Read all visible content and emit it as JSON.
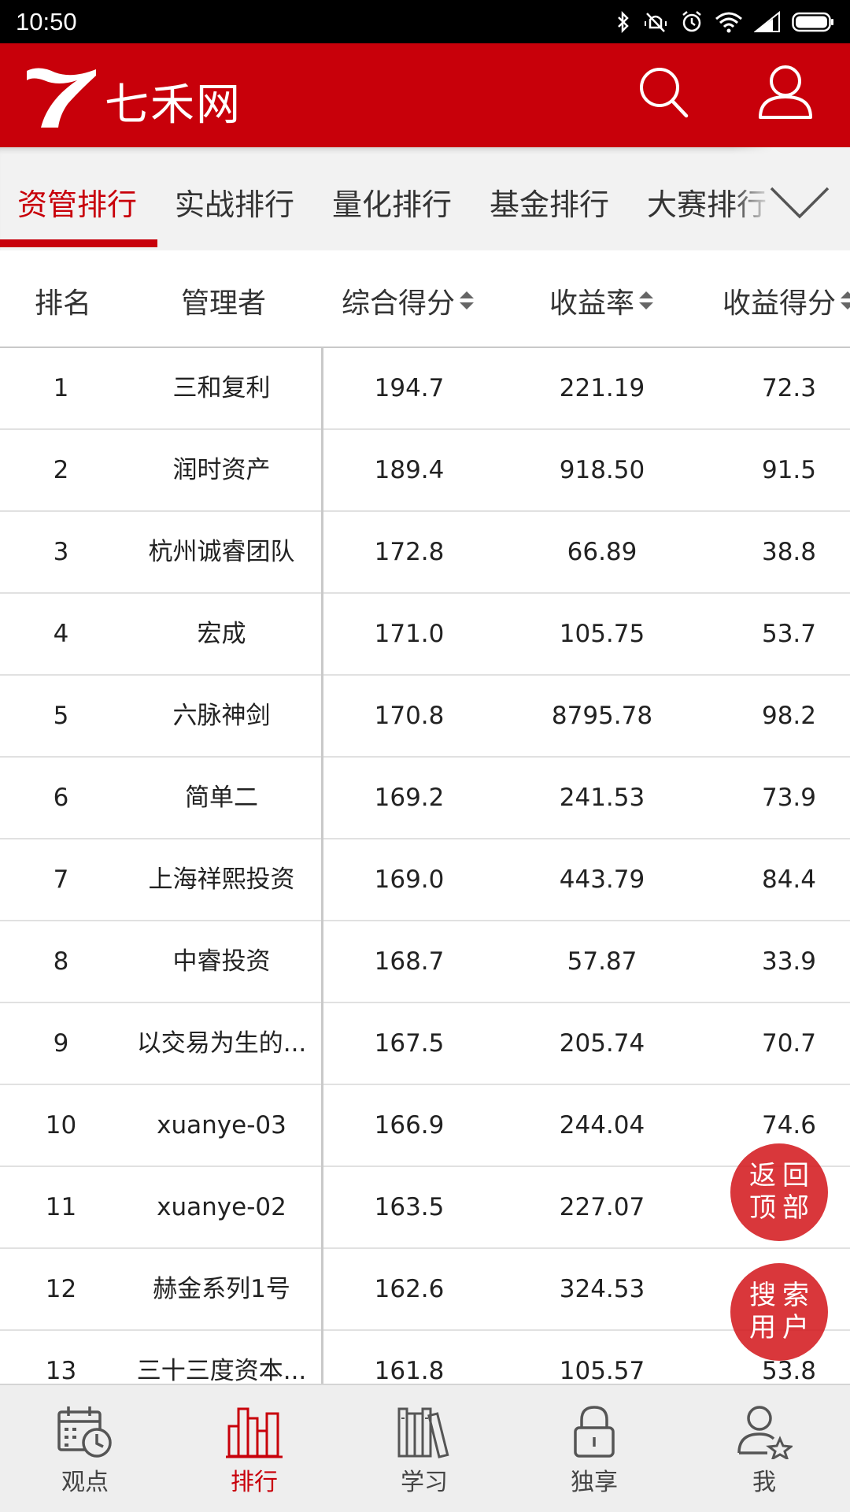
{
  "status_bar": {
    "time": "10:50"
  },
  "header": {
    "app_title": "七禾网"
  },
  "tabs": [
    {
      "label": "资管排行",
      "active": true
    },
    {
      "label": "实战排行",
      "active": false
    },
    {
      "label": "量化排行",
      "active": false
    },
    {
      "label": "基金排行",
      "active": false
    },
    {
      "label": "大赛排行",
      "active": false
    }
  ],
  "table": {
    "headers": {
      "rank": "排名",
      "manager": "管理者",
      "composite_score": "综合得分",
      "return_rate": "收益率",
      "return_score": "收益得分"
    },
    "rows": [
      {
        "rank": "1",
        "manager": "三和复利",
        "score": "194.7",
        "return": "221.19",
        "rscore": "72.3"
      },
      {
        "rank": "2",
        "manager": "润时资产",
        "score": "189.4",
        "return": "918.50",
        "rscore": "91.5"
      },
      {
        "rank": "3",
        "manager": "杭州诚睿团队",
        "score": "172.8",
        "return": "66.89",
        "rscore": "38.8"
      },
      {
        "rank": "4",
        "manager": "宏成",
        "score": "171.0",
        "return": "105.75",
        "rscore": "53.7"
      },
      {
        "rank": "5",
        "manager": "六脉神剑",
        "score": "170.8",
        "return": "8795.78",
        "rscore": "98.2"
      },
      {
        "rank": "6",
        "manager": "简单二",
        "score": "169.2",
        "return": "241.53",
        "rscore": "73.9"
      },
      {
        "rank": "7",
        "manager": "上海祥熙投资",
        "score": "169.0",
        "return": "443.79",
        "rscore": "84.4"
      },
      {
        "rank": "8",
        "manager": "中睿投资",
        "score": "168.7",
        "return": "57.87",
        "rscore": "33.9"
      },
      {
        "rank": "9",
        "manager": "以交易为生的...",
        "score": "167.5",
        "return": "205.74",
        "rscore": "70.7"
      },
      {
        "rank": "10",
        "manager": "xuanye-03",
        "score": "166.9",
        "return": "244.04",
        "rscore": "74.6"
      },
      {
        "rank": "11",
        "manager": "xuanye-02",
        "score": "163.5",
        "return": "227.07",
        "rscore": ""
      },
      {
        "rank": "12",
        "manager": "赫金系列1号",
        "score": "162.6",
        "return": "324.53",
        "rscore": ""
      },
      {
        "rank": "13",
        "manager": "三十三度资本...",
        "score": "161.8",
        "return": "105.57",
        "rscore": "53.8"
      }
    ]
  },
  "floating": {
    "back_to_top_line1": "返回",
    "back_to_top_line2": "顶部",
    "search_user_line1": "搜索",
    "search_user_line2": "用户"
  },
  "bottom_nav": [
    {
      "label": "观点",
      "icon": "calendar-clock-icon",
      "active": false
    },
    {
      "label": "排行",
      "icon": "bar-chart-icon",
      "active": true
    },
    {
      "label": "学习",
      "icon": "books-icon",
      "active": false
    },
    {
      "label": "独享",
      "icon": "lock-icon",
      "active": false
    },
    {
      "label": "我",
      "icon": "user-star-icon",
      "active": false
    }
  ],
  "colors": {
    "brand": "#c8000a",
    "nav_bg": "#eeeeee"
  }
}
